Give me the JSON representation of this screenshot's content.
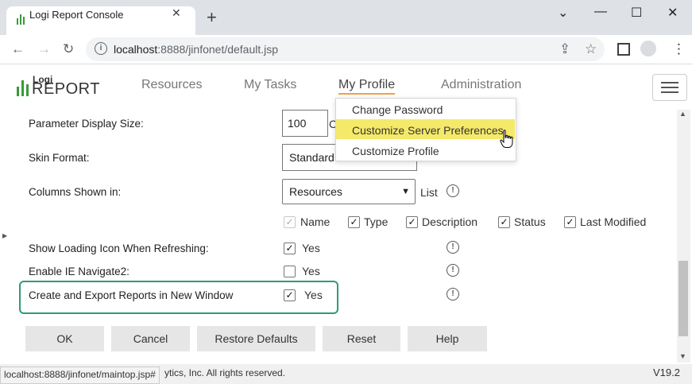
{
  "browser": {
    "tab_title": "Logi Report Console",
    "tab_close": "✕",
    "new_tab": "+",
    "url_host": "localhost",
    "url_path": ":8888/jinfonet/default.jsp",
    "window_controls": [
      "⌄",
      "—",
      "☐",
      "✕"
    ]
  },
  "app": {
    "logo_top": "Logi",
    "logo_bottom": "REPORT",
    "nav": [
      "Resources",
      "My Tasks",
      "My Profile",
      "Administration"
    ]
  },
  "dropdown": {
    "items": [
      "Change Password",
      "Customize Server Preferences",
      "Customize Profile"
    ]
  },
  "form": {
    "param_display_size_label": "Parameter Display Size:",
    "param_display_size_value": "100",
    "param_display_size_suffix": "C",
    "skin_format_label": "Skin Format:",
    "skin_format_value": "Standard",
    "columns_shown_label": "Columns Shown in:",
    "columns_shown_value": "Resources",
    "columns_shown_suffix": "List",
    "columns": [
      "Name",
      "Type",
      "Description",
      "Status",
      "Last Modified"
    ],
    "show_loading_label": "Show Loading Icon When Refreshing:",
    "enable_ie_label": "Enable IE Navigate2:",
    "create_export_label": "Create and Export Reports in New Window",
    "yes": "Yes"
  },
  "buttons": [
    "OK",
    "Cancel",
    "Restore Defaults",
    "Reset",
    "Help"
  ],
  "footer": {
    "status_url": "localhost:8888/jinfonet/maintop.jsp#",
    "copyright": "ytics, Inc. All rights reserved.",
    "version": "V19.2"
  },
  "colors": {
    "highlight_border": "#2e9b7c",
    "menu_highlight": "#f5e96a",
    "nav_underline": "#f0a04b"
  }
}
